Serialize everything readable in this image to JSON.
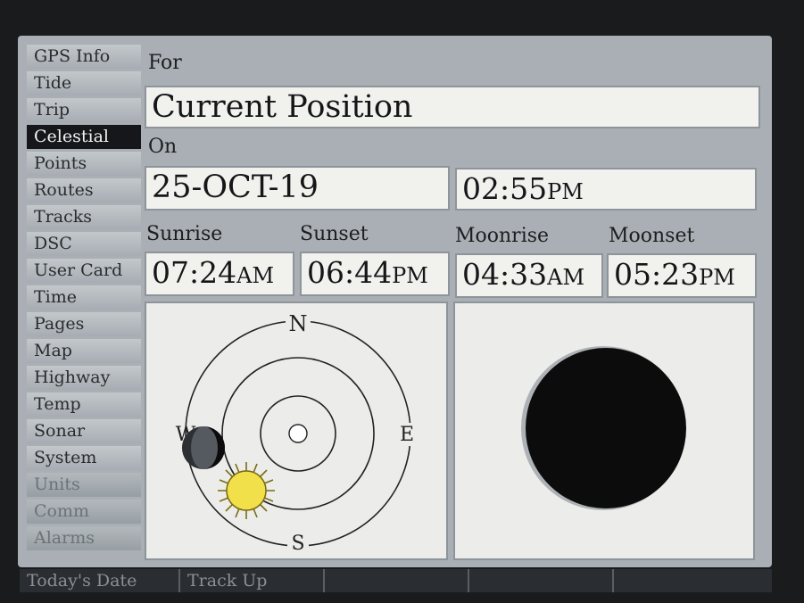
{
  "sidebar": {
    "items": [
      {
        "label": "GPS Info"
      },
      {
        "label": "Tide"
      },
      {
        "label": "Trip"
      },
      {
        "label": "Celestial"
      },
      {
        "label": "Points"
      },
      {
        "label": "Routes"
      },
      {
        "label": "Tracks"
      },
      {
        "label": "DSC"
      },
      {
        "label": "User Card"
      },
      {
        "label": "Time"
      },
      {
        "label": "Pages"
      },
      {
        "label": "Map"
      },
      {
        "label": "Highway"
      },
      {
        "label": "Temp"
      },
      {
        "label": "Sonar"
      },
      {
        "label": "System"
      },
      {
        "label": "Units"
      },
      {
        "label": "Comm"
      },
      {
        "label": "Alarms"
      }
    ],
    "selected": "Celestial"
  },
  "for_label": "For",
  "position": "Current Position",
  "on_label": "On",
  "date": "25-OCT-19",
  "time": {
    "value": "02:55",
    "suffix": "PM"
  },
  "events": [
    {
      "label": "Sunrise",
      "value": "07:24",
      "suffix": "AM"
    },
    {
      "label": "Sunset",
      "value": "06:44",
      "suffix": "PM"
    },
    {
      "label": "Moonrise",
      "value": "04:33",
      "suffix": "AM"
    },
    {
      "label": "Moonset",
      "value": "05:23",
      "suffix": "PM"
    }
  ],
  "compass": {
    "n": "N",
    "s": "S",
    "e": "E",
    "w": "W"
  },
  "softkeys": [
    {
      "label": "Today's Date"
    },
    {
      "label": "Track Up"
    },
    {
      "label": ""
    },
    {
      "label": ""
    },
    {
      "label": ""
    }
  ],
  "colors": {
    "selected_bg": "#15171a",
    "sun": "#f2e04a",
    "moon": "#111111"
  }
}
